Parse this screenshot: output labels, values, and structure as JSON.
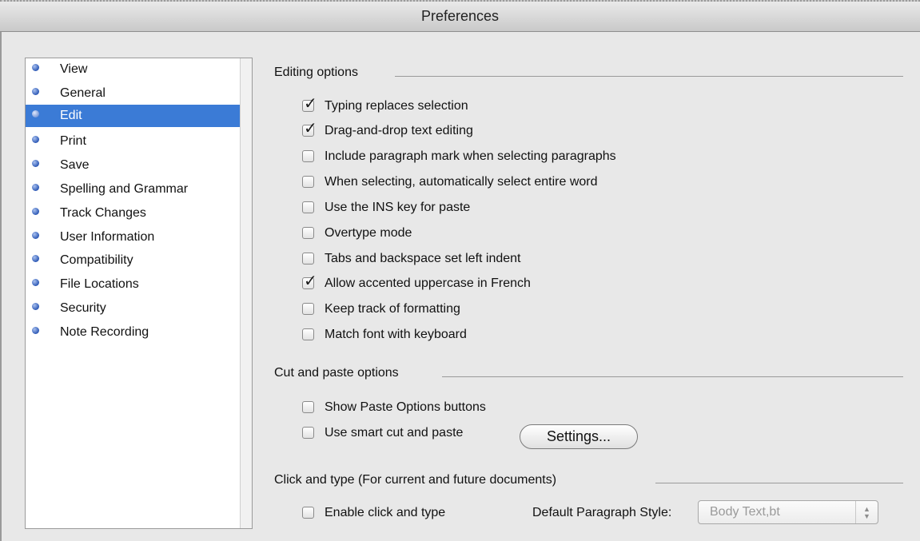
{
  "window": {
    "title": "Preferences"
  },
  "sidebar": {
    "items": [
      {
        "label": "View",
        "selected": false
      },
      {
        "label": "General",
        "selected": false
      },
      {
        "label": "Edit",
        "selected": true
      },
      {
        "label": "Print",
        "selected": false
      },
      {
        "label": "Save",
        "selected": false
      },
      {
        "label": "Spelling and Grammar",
        "selected": false
      },
      {
        "label": "Track Changes",
        "selected": false
      },
      {
        "label": "User Information",
        "selected": false
      },
      {
        "label": "Compatibility",
        "selected": false
      },
      {
        "label": "File Locations",
        "selected": false
      },
      {
        "label": "Security",
        "selected": false
      },
      {
        "label": "Note Recording",
        "selected": false
      }
    ]
  },
  "editing": {
    "header": "Editing options",
    "options": [
      {
        "label": "Typing replaces selection",
        "checked": true
      },
      {
        "label": "Drag-and-drop text editing",
        "checked": true
      },
      {
        "label": "Include paragraph mark when selecting paragraphs",
        "checked": false
      },
      {
        "label": "When selecting, automatically select entire word",
        "checked": false
      },
      {
        "label": "Use the INS key for paste",
        "checked": false
      },
      {
        "label": "Overtype mode",
        "checked": false
      },
      {
        "label": "Tabs and backspace set left indent",
        "checked": false
      },
      {
        "label": "Allow accented uppercase in French",
        "checked": true
      },
      {
        "label": "Keep track of formatting",
        "checked": false
      },
      {
        "label": "Match font with keyboard",
        "checked": false
      }
    ]
  },
  "cutpaste": {
    "header": "Cut and paste options",
    "options": [
      {
        "label": "Show Paste Options buttons",
        "checked": false
      },
      {
        "label": "Use smart cut and paste",
        "checked": false
      }
    ],
    "settings_button": "Settings..."
  },
  "clicktype": {
    "header": "Click and type (For current and future documents)",
    "option": {
      "label": "Enable click and type",
      "checked": false
    },
    "style_label": "Default Paragraph Style:",
    "style_value": "Body Text,bt"
  },
  "colors": {
    "selection": "#3b7bd6",
    "bullet": "#2d59b5"
  }
}
